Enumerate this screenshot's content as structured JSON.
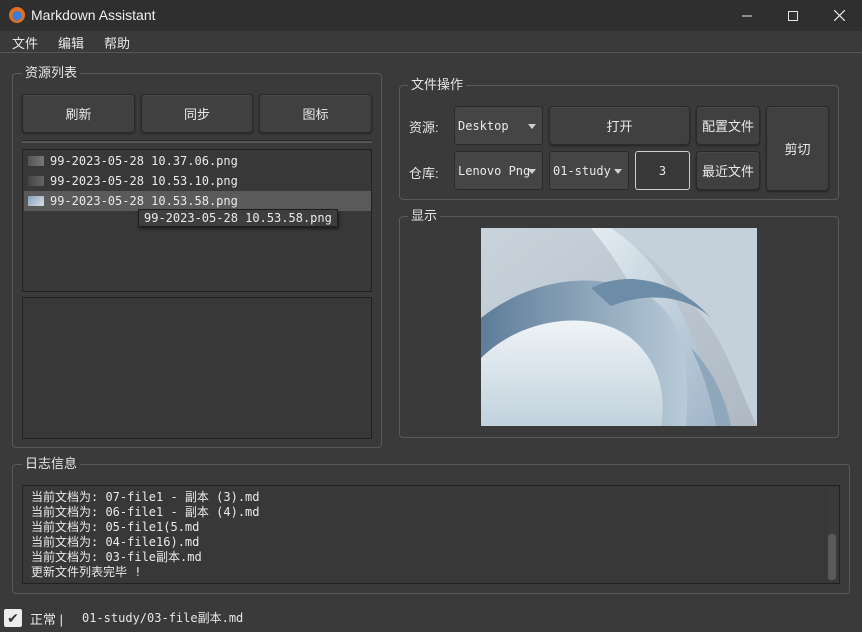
{
  "window": {
    "title": "Markdown Assistant"
  },
  "menu": {
    "items": [
      "文件",
      "编辑",
      "帮助"
    ]
  },
  "resource_panel": {
    "title": "资源列表",
    "buttons": {
      "refresh": "刷新",
      "sync": "同步",
      "icons": "图标"
    },
    "files": [
      {
        "name": "99-2023-05-28 10.37.06.png",
        "selected": false
      },
      {
        "name": "99-2023-05-28 10.53.10.png",
        "selected": false
      },
      {
        "name": "99-2023-05-28 10.53.58.png",
        "selected": true
      }
    ],
    "tooltip": "99-2023-05-28 10.53.58.png"
  },
  "file_ops": {
    "title": "文件操作",
    "resource_label": "资源:",
    "resource_value": "Desktop",
    "repo_label": "仓库:",
    "repo_value": "Lenovo Png",
    "folder_value": "01-study",
    "count_value": "3",
    "open_button": "打开",
    "config_button": "配置文件",
    "recent_button": "最近文件",
    "cut_button": "剪切"
  },
  "display": {
    "title": "显示"
  },
  "log": {
    "title": "日志信息",
    "lines": [
      "当前文档为: 07-file1 - 副本 (3).md",
      "当前文档为: 06-file1 - 副本 (4).md",
      "当前文档为: 05-file1(5.md",
      "当前文档为: 04-file16).md",
      "当前文档为: 03-file副本.md",
      "更新文件列表完毕 !"
    ]
  },
  "status": {
    "state": "正常 |",
    "path": "01-study/03-file副本.md"
  },
  "colors": {
    "background": "#3a3a3a",
    "titlebar": "#2f2f2f",
    "selection": "#5a5a5a",
    "accent": "#e0701e"
  }
}
